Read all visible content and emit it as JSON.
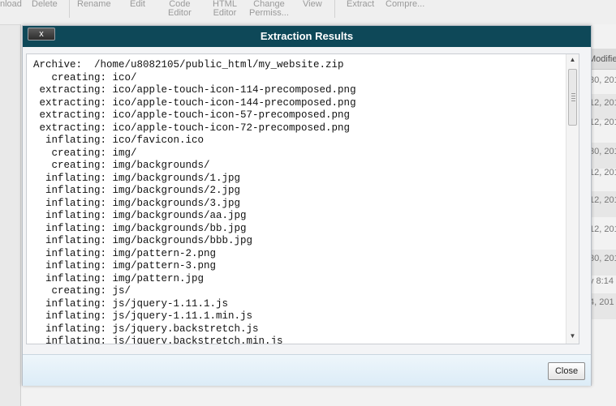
{
  "toolbar": {
    "items": [
      {
        "line1": "nload",
        "line2": ""
      },
      {
        "line1": "Delete",
        "line2": ""
      },
      {
        "line1": "Rename",
        "line2": ""
      },
      {
        "line1": "Edit",
        "line2": ""
      },
      {
        "line1": "Code",
        "line2": "Editor"
      },
      {
        "line1": "HTML",
        "line2": "Editor"
      },
      {
        "line1": "Change",
        "line2": "Permiss..."
      },
      {
        "line1": "View",
        "line2": ""
      },
      {
        "line1": "Extract",
        "line2": ""
      },
      {
        "line1": "Compre...",
        "line2": ""
      }
    ]
  },
  "background_list": {
    "column_header": "Modifie",
    "rows": [
      "30, 201",
      "12, 201",
      "12, 201",
      "30, 201",
      "12, 201",
      "12, 201",
      "12, 201",
      "30, 201",
      "y 8:14 I",
      "4, 201"
    ]
  },
  "dialog": {
    "title": "Extraction Results",
    "close_x_label": "x",
    "close_button_label": "Close",
    "log_lines": [
      "Archive:  /home/u8082105/public_html/my_website.zip",
      "   creating: ico/",
      " extracting: ico/apple-touch-icon-114-precomposed.png",
      " extracting: ico/apple-touch-icon-144-precomposed.png",
      " extracting: ico/apple-touch-icon-57-precomposed.png",
      " extracting: ico/apple-touch-icon-72-precomposed.png",
      "  inflating: ico/favicon.ico",
      "   creating: img/",
      "   creating: img/backgrounds/",
      "  inflating: img/backgrounds/1.jpg",
      "  inflating: img/backgrounds/2.jpg",
      "  inflating: img/backgrounds/3.jpg",
      "  inflating: img/backgrounds/aa.jpg",
      "  inflating: img/backgrounds/bb.jpg",
      "  inflating: img/backgrounds/bbb.jpg",
      "  inflating: img/pattern-2.png",
      "  inflating: img/pattern-3.png",
      "  inflating: img/pattern.jpg",
      "   creating: js/",
      "  inflating: js/jquery-1.11.1.js",
      "  inflating: js/jquery-1.11.1.min.js",
      "  inflating: js/jquery.backstretch.js",
      "  inflating: js/jquery.backstretch.min.js"
    ]
  }
}
